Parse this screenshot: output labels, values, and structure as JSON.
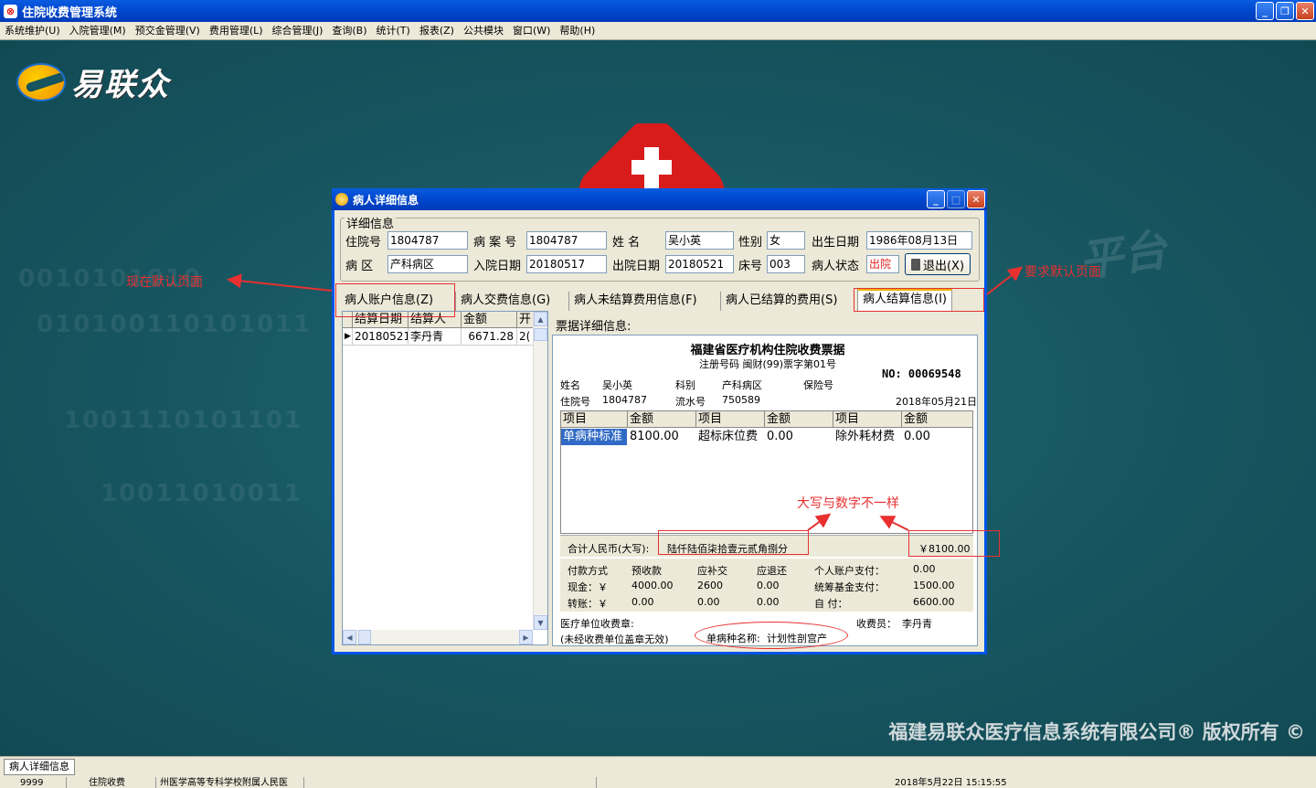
{
  "window": {
    "title": "住院收费管理系统",
    "icon_glyph": "⊗"
  },
  "menu": [
    "系统维护(U)",
    "入院管理(M)",
    "预交金管理(V)",
    "费用管理(L)",
    "综合管理(J)",
    "查询(B)",
    "统计(T)",
    "报表(Z)",
    "公共模块",
    "窗口(W)",
    "帮助(H)"
  ],
  "desktop": {
    "logo_text": "易联众",
    "copyright": "福建易联众医疗信息系统有限公司® 版权所有 ©",
    "watermark": "平台"
  },
  "dialog": {
    "title": "病人详细信息",
    "group_title": "详细信息",
    "fields": {
      "zyh_label": "住院号",
      "zyh": "1804787",
      "bah_label": "病 案 号",
      "bah": "1804787",
      "xm_label": "姓    名",
      "xm": "吴小英",
      "xb_label": "性别",
      "xb": "女",
      "csrq_label": "出生日期",
      "csrq": "1986年08月13日",
      "bq_label": "病   区",
      "bq": "产科病区",
      "ryrq_label": "入院日期",
      "ryrq": "20180517",
      "cyrq_label": "出院日期",
      "cyrq": "20180521",
      "ch_label": "床号",
      "ch": "003",
      "zt_label": "病人状态",
      "zt": "出院"
    },
    "exit_label": "退出(X)",
    "tabs": [
      "病人账户信息(Z)",
      "病人交费信息(G)",
      "病人未结算费用信息(F)",
      "病人已结算的费用(S)",
      "病人结算信息(I)"
    ],
    "active_tab": 4,
    "grid": {
      "headers": [
        "结算日期",
        "结算人",
        "金额",
        "开"
      ],
      "rows": [
        [
          "20180521",
          "李丹青",
          "6671.28",
          "2("
        ]
      ]
    },
    "receipt_label": "票据详细信息:",
    "receipt": {
      "title": "福建省医疗机构住院收费票据",
      "subtitle": "注册号码 闽财(99)票字第01号",
      "no": "NO: 00069548",
      "name_label": "姓名",
      "name": "吴小英",
      "dept_label": "科别",
      "dept": "产科病区",
      "ins_label": "保险号",
      "zyh_label": "住院号",
      "zyh": "1804787",
      "lsh_label": "流水号",
      "lsh": "750589",
      "date": "2018年05月21日",
      "table_headers": [
        "项目",
        "金额",
        "项目",
        "金额",
        "项目",
        "金额"
      ],
      "table_row": [
        "单病种标准",
        "8100.00",
        "超标床位费",
        "0.00",
        "除外耗材费",
        "0.00"
      ],
      "total_label": "合计人民币(大写):",
      "total_words": "陆仟陆佰柒拾壹元贰角捌分",
      "total_amount": "￥8100.00",
      "pay_headers": [
        "付款方式",
        "预收款",
        "应补交",
        "应退还",
        "个人账户支付：",
        "0.00"
      ],
      "pay_row1": [
        "现金：￥",
        "4000.00",
        "2600",
        "0.00",
        "统筹基金支付：",
        "1500.00"
      ],
      "pay_row2": [
        "转账：￥",
        "0.00",
        "0.00",
        "0.00",
        "自        付：",
        "6600.00"
      ],
      "foot_stamp": "医疗单位收费章:",
      "foot_note": "(未经收费单位盖章无效)",
      "cashier_label": "收费员：",
      "cashier": "李丹青",
      "disease_label": "单病种名称:",
      "disease": "计划性剖宫产"
    }
  },
  "annotations": {
    "current_default": "现在默认页面",
    "required_default": "要求默认页面",
    "mismatch": "大写与数字不一样",
    "color": "#e83030"
  },
  "statusbar": {
    "task_tab": "病人详细信息",
    "cells": [
      "9999",
      "住院收费",
      "州医学高等专科学校附属人民医",
      "",
      "2018年5月22日 15:15:55"
    ]
  }
}
